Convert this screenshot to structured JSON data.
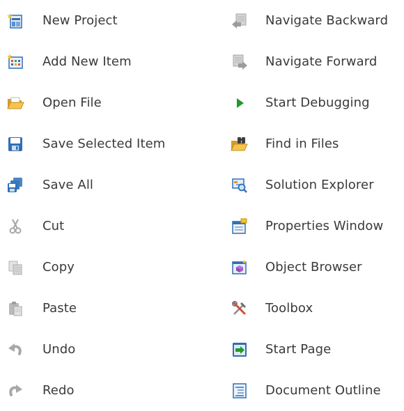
{
  "left_items": [
    {
      "label": "New Project",
      "icon": "new-project-icon"
    },
    {
      "label": "Add New Item",
      "icon": "add-new-item-icon"
    },
    {
      "label": "Open File",
      "icon": "open-file-icon"
    },
    {
      "label": "Save Selected Item",
      "icon": "save-icon"
    },
    {
      "label": "Save All",
      "icon": "save-all-icon"
    },
    {
      "label": "Cut",
      "icon": "cut-icon"
    },
    {
      "label": "Copy",
      "icon": "copy-icon"
    },
    {
      "label": "Paste",
      "icon": "paste-icon"
    },
    {
      "label": "Undo",
      "icon": "undo-icon"
    },
    {
      "label": "Redo",
      "icon": "redo-icon"
    }
  ],
  "right_items": [
    {
      "label": "Navigate Backward",
      "icon": "navigate-backward-icon"
    },
    {
      "label": "Navigate Forward",
      "icon": "navigate-forward-icon"
    },
    {
      "label": "Start Debugging",
      "icon": "start-debugging-icon"
    },
    {
      "label": "Find in Files",
      "icon": "find-in-files-icon"
    },
    {
      "label": "Solution Explorer",
      "icon": "solution-explorer-icon"
    },
    {
      "label": "Properties Window",
      "icon": "properties-window-icon"
    },
    {
      "label": "Object Browser",
      "icon": "object-browser-icon"
    },
    {
      "label": "Toolbox",
      "icon": "toolbox-icon"
    },
    {
      "label": "Start Page",
      "icon": "start-page-icon"
    },
    {
      "label": "Document Outline",
      "icon": "document-outline-icon"
    }
  ],
  "colors": {
    "text": "#3a3a3a",
    "icon_blue": "#2f6fb5",
    "icon_gray": "#a8a8a8",
    "icon_green": "#1f9a2a",
    "icon_yellow": "#f2c32b"
  }
}
